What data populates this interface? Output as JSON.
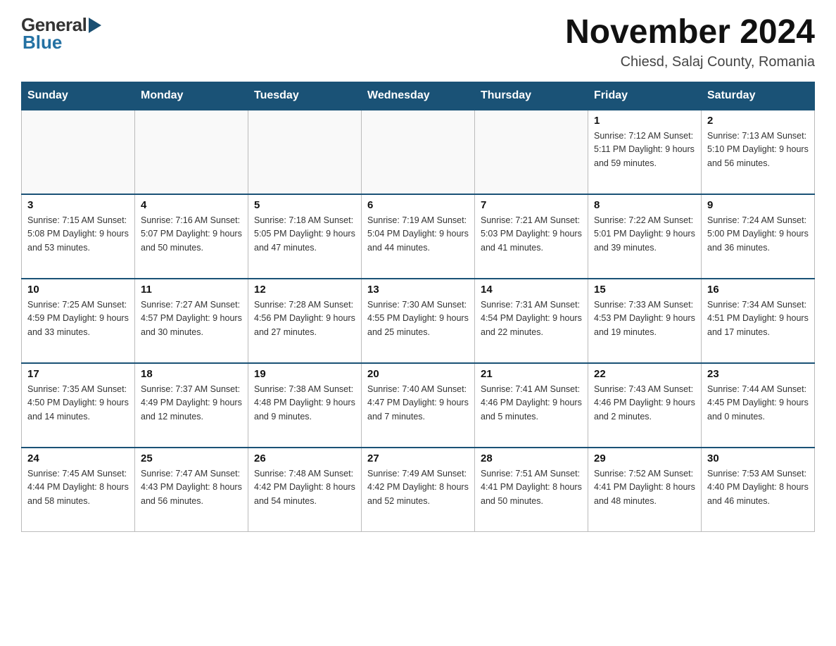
{
  "logo": {
    "general": "General",
    "blue": "Blue"
  },
  "header": {
    "title": "November 2024",
    "subtitle": "Chiesd, Salaj County, Romania"
  },
  "weekdays": [
    "Sunday",
    "Monday",
    "Tuesday",
    "Wednesday",
    "Thursday",
    "Friday",
    "Saturday"
  ],
  "weeks": [
    {
      "days": [
        {
          "number": "",
          "info": ""
        },
        {
          "number": "",
          "info": ""
        },
        {
          "number": "",
          "info": ""
        },
        {
          "number": "",
          "info": ""
        },
        {
          "number": "",
          "info": ""
        },
        {
          "number": "1",
          "info": "Sunrise: 7:12 AM\nSunset: 5:11 PM\nDaylight: 9 hours\nand 59 minutes."
        },
        {
          "number": "2",
          "info": "Sunrise: 7:13 AM\nSunset: 5:10 PM\nDaylight: 9 hours\nand 56 minutes."
        }
      ]
    },
    {
      "days": [
        {
          "number": "3",
          "info": "Sunrise: 7:15 AM\nSunset: 5:08 PM\nDaylight: 9 hours\nand 53 minutes."
        },
        {
          "number": "4",
          "info": "Sunrise: 7:16 AM\nSunset: 5:07 PM\nDaylight: 9 hours\nand 50 minutes."
        },
        {
          "number": "5",
          "info": "Sunrise: 7:18 AM\nSunset: 5:05 PM\nDaylight: 9 hours\nand 47 minutes."
        },
        {
          "number": "6",
          "info": "Sunrise: 7:19 AM\nSunset: 5:04 PM\nDaylight: 9 hours\nand 44 minutes."
        },
        {
          "number": "7",
          "info": "Sunrise: 7:21 AM\nSunset: 5:03 PM\nDaylight: 9 hours\nand 41 minutes."
        },
        {
          "number": "8",
          "info": "Sunrise: 7:22 AM\nSunset: 5:01 PM\nDaylight: 9 hours\nand 39 minutes."
        },
        {
          "number": "9",
          "info": "Sunrise: 7:24 AM\nSunset: 5:00 PM\nDaylight: 9 hours\nand 36 minutes."
        }
      ]
    },
    {
      "days": [
        {
          "number": "10",
          "info": "Sunrise: 7:25 AM\nSunset: 4:59 PM\nDaylight: 9 hours\nand 33 minutes."
        },
        {
          "number": "11",
          "info": "Sunrise: 7:27 AM\nSunset: 4:57 PM\nDaylight: 9 hours\nand 30 minutes."
        },
        {
          "number": "12",
          "info": "Sunrise: 7:28 AM\nSunset: 4:56 PM\nDaylight: 9 hours\nand 27 minutes."
        },
        {
          "number": "13",
          "info": "Sunrise: 7:30 AM\nSunset: 4:55 PM\nDaylight: 9 hours\nand 25 minutes."
        },
        {
          "number": "14",
          "info": "Sunrise: 7:31 AM\nSunset: 4:54 PM\nDaylight: 9 hours\nand 22 minutes."
        },
        {
          "number": "15",
          "info": "Sunrise: 7:33 AM\nSunset: 4:53 PM\nDaylight: 9 hours\nand 19 minutes."
        },
        {
          "number": "16",
          "info": "Sunrise: 7:34 AM\nSunset: 4:51 PM\nDaylight: 9 hours\nand 17 minutes."
        }
      ]
    },
    {
      "days": [
        {
          "number": "17",
          "info": "Sunrise: 7:35 AM\nSunset: 4:50 PM\nDaylight: 9 hours\nand 14 minutes."
        },
        {
          "number": "18",
          "info": "Sunrise: 7:37 AM\nSunset: 4:49 PM\nDaylight: 9 hours\nand 12 minutes."
        },
        {
          "number": "19",
          "info": "Sunrise: 7:38 AM\nSunset: 4:48 PM\nDaylight: 9 hours\nand 9 minutes."
        },
        {
          "number": "20",
          "info": "Sunrise: 7:40 AM\nSunset: 4:47 PM\nDaylight: 9 hours\nand 7 minutes."
        },
        {
          "number": "21",
          "info": "Sunrise: 7:41 AM\nSunset: 4:46 PM\nDaylight: 9 hours\nand 5 minutes."
        },
        {
          "number": "22",
          "info": "Sunrise: 7:43 AM\nSunset: 4:46 PM\nDaylight: 9 hours\nand 2 minutes."
        },
        {
          "number": "23",
          "info": "Sunrise: 7:44 AM\nSunset: 4:45 PM\nDaylight: 9 hours\nand 0 minutes."
        }
      ]
    },
    {
      "days": [
        {
          "number": "24",
          "info": "Sunrise: 7:45 AM\nSunset: 4:44 PM\nDaylight: 8 hours\nand 58 minutes."
        },
        {
          "number": "25",
          "info": "Sunrise: 7:47 AM\nSunset: 4:43 PM\nDaylight: 8 hours\nand 56 minutes."
        },
        {
          "number": "26",
          "info": "Sunrise: 7:48 AM\nSunset: 4:42 PM\nDaylight: 8 hours\nand 54 minutes."
        },
        {
          "number": "27",
          "info": "Sunrise: 7:49 AM\nSunset: 4:42 PM\nDaylight: 8 hours\nand 52 minutes."
        },
        {
          "number": "28",
          "info": "Sunrise: 7:51 AM\nSunset: 4:41 PM\nDaylight: 8 hours\nand 50 minutes."
        },
        {
          "number": "29",
          "info": "Sunrise: 7:52 AM\nSunset: 4:41 PM\nDaylight: 8 hours\nand 48 minutes."
        },
        {
          "number": "30",
          "info": "Sunrise: 7:53 AM\nSunset: 4:40 PM\nDaylight: 8 hours\nand 46 minutes."
        }
      ]
    }
  ]
}
